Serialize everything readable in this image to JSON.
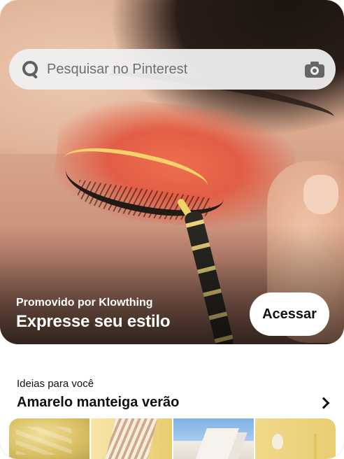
{
  "search": {
    "placeholder": "Pesquisar no Pinterest"
  },
  "promo": {
    "sponsor_line": "Promovido por Klowthing",
    "title": "Expresse seu estilo",
    "cta_label": "Acessar"
  },
  "ideas": {
    "kicker": "Ideias para você",
    "title": "Amarelo manteiga verão",
    "thumbnails": [
      {
        "name": "yellow-fabric-thumbnail"
      },
      {
        "name": "striped-shirt-thumbnail"
      },
      {
        "name": "sky-building-thumbnail"
      },
      {
        "name": "candle-flower-thumbnail"
      }
    ]
  },
  "colors": {
    "search_bg": "#f0f0f0",
    "text_primary": "#111111",
    "cta_bg": "#ffffff",
    "eyeshadow": "#e25d45",
    "eyeliner": "#f3d36a"
  }
}
